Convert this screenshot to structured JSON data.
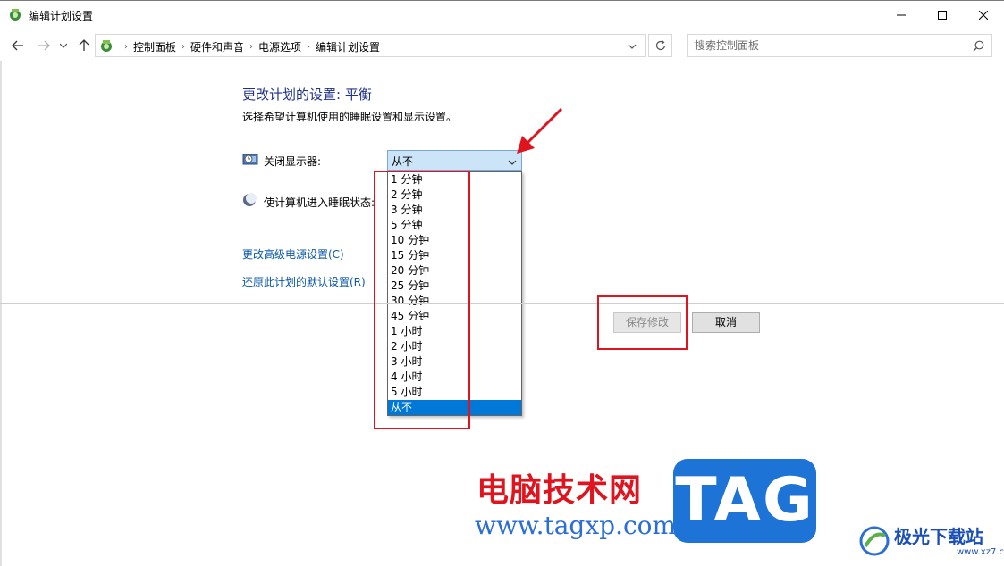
{
  "window": {
    "title": "编辑计划设置"
  },
  "address": {
    "crumbs": [
      "控制面板",
      "硬件和声音",
      "电源选项",
      "编辑计划设置"
    ]
  },
  "search": {
    "placeholder": "搜索控制面板"
  },
  "content": {
    "heading": "更改计划的设置: 平衡",
    "subtext": "选择希望计算机使用的睡眠设置和显示设置。",
    "display_off_label": "关闭显示器:",
    "sleep_label": "使计算机进入睡眠状态:",
    "display_off_value": "从不",
    "options": [
      "1 分钟",
      "2 分钟",
      "3 分钟",
      "5 分钟",
      "10 分钟",
      "15 分钟",
      "20 分钟",
      "25 分钟",
      "30 分钟",
      "45 分钟",
      "1 小时",
      "2 小时",
      "3 小时",
      "4 小时",
      "5 小时",
      "从不"
    ],
    "selected_option": "从不",
    "link_advanced": "更改高级电源设置(C)",
    "link_restore": "还原此计划的默认设置(R)"
  },
  "buttons": {
    "save": "保存修改",
    "cancel": "取消"
  },
  "watermark": {
    "site_name": "电脑技术网",
    "site_url": "www.tagxp.com",
    "tag": "TAG",
    "logo_name": "极光下载站",
    "logo_url": "www.xz7.com"
  },
  "colors": {
    "heading": "#1e3287",
    "link": "#0b57a8",
    "selection": "#0078d7",
    "annotation": "#e0141e"
  }
}
